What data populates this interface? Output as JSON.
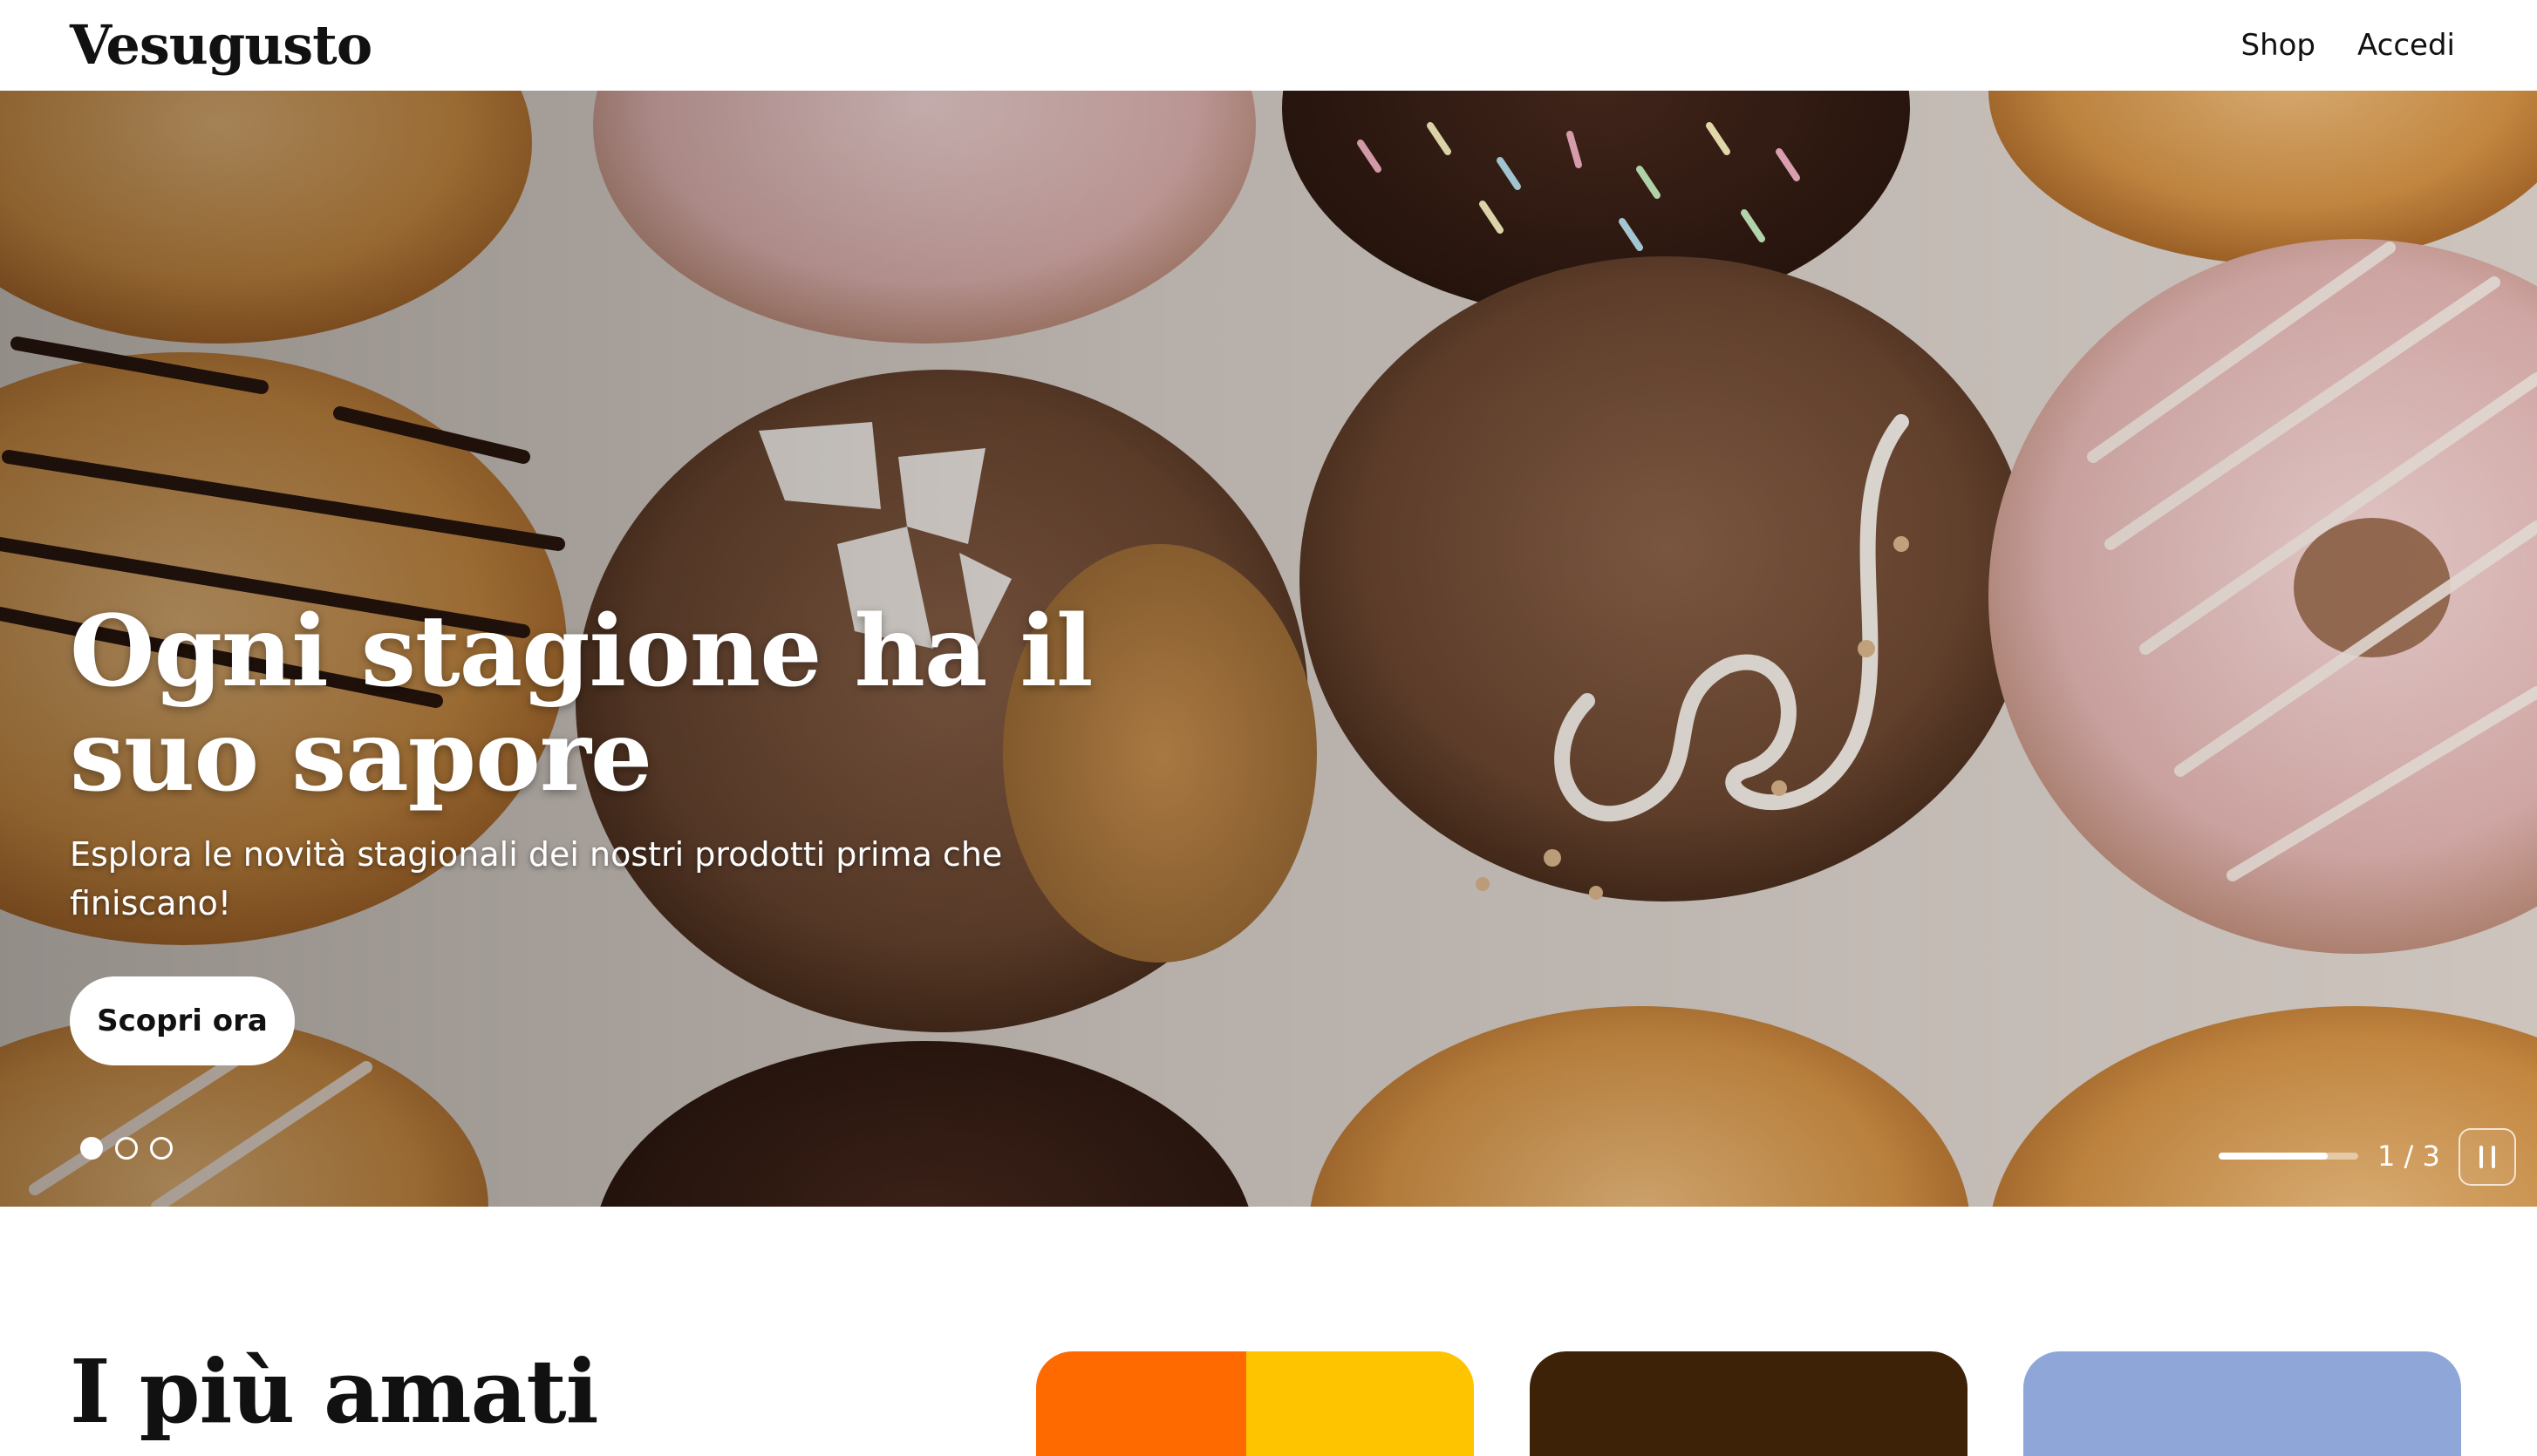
{
  "header": {
    "logo": "Vesugusto",
    "nav": {
      "shop": "Shop",
      "login": "Accedi"
    }
  },
  "hero": {
    "title": "Ogni stagione ha il suo sapore",
    "subtitle": "Esplora le novità stagionali dei nostri prodotti prima che finiscano!",
    "cta_label": "Scopri ora",
    "slides_total": 3,
    "active_slide": 1,
    "counter": "1 / 3",
    "progress_fraction": 0.78,
    "image_description_icon": "donuts-photo"
  },
  "section": {
    "title": "I più amati"
  },
  "colors": {
    "cta_bg": "#ffffff",
    "card1_orange": "#ff6a00",
    "card1_yellow": "#ffc400",
    "card2_brown": "#3d2208",
    "card3_blue": "#8fa7d8"
  }
}
